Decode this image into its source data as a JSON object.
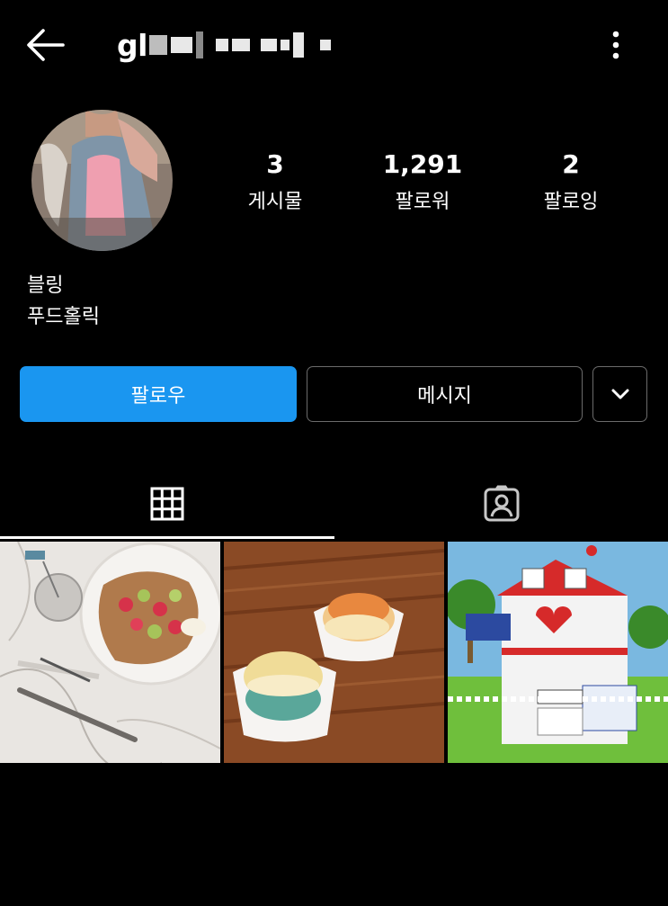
{
  "header": {
    "username": "gl",
    "back_icon": "arrow-left-icon",
    "more_icon": "kebab-vertical-icon"
  },
  "profile": {
    "stats": {
      "posts": {
        "value": "3",
        "label": "게시물"
      },
      "followers": {
        "value": "1,291",
        "label": "팔로워"
      },
      "following": {
        "value": "2",
        "label": "팔로잉"
      }
    },
    "bio": {
      "name": "블링",
      "category": "푸드홀릭"
    }
  },
  "actions": {
    "follow_label": "팔로우",
    "message_label": "메시지",
    "dropdown_icon": "chevron-down-icon"
  },
  "tabs": [
    {
      "icon": "grid-icon",
      "selected": true
    },
    {
      "icon": "tagged-person-icon",
      "selected": false
    }
  ],
  "posts": [
    {
      "subject": "waffle with strawberries and cream"
    },
    {
      "subject": "macarons in paper cups"
    },
    {
      "subject": "lego red cross building"
    }
  ],
  "colors": {
    "background": "#000000",
    "accent": "#1a96f0",
    "border": "#6b6b6b",
    "text": "#ffffff"
  }
}
